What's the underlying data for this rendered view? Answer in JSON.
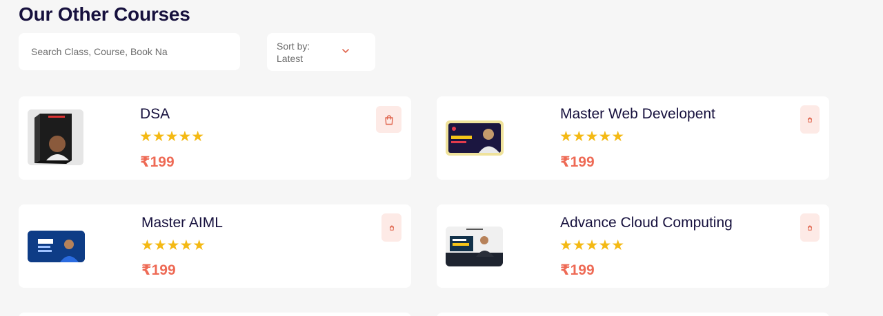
{
  "header": {
    "title": "Our Other Courses"
  },
  "search": {
    "placeholder": "Search Class, Course, Book Na",
    "value": ""
  },
  "sort": {
    "label": "Sort by:",
    "value": "Latest"
  },
  "colors": {
    "title": "#16103d",
    "price": "#ee6a55",
    "star": "#f4b914",
    "bag_bg": "#fdeae6",
    "bag_icon": "#e0664f"
  },
  "courses": [
    {
      "name": "DSA",
      "rating_stars": "★★★★★",
      "rating": 5,
      "price": "₹199",
      "thumbnail_text": "CLICKS INTO CUSTOMERS 2.0"
    },
    {
      "name": "Master Web Developent",
      "rating_stars": "★★★★★",
      "rating": 5,
      "price": "₹199",
      "thumbnail_text": "FREELANCING"
    },
    {
      "name": "Master AIML",
      "rating_stars": "★★★★★",
      "rating": 5,
      "price": "₹199",
      "thumbnail_text": "LEARN"
    },
    {
      "name": "Advance Cloud Computing",
      "rating_stars": "★★★★★",
      "rating": 5,
      "price": "₹199",
      "thumbnail_text": ""
    }
  ]
}
